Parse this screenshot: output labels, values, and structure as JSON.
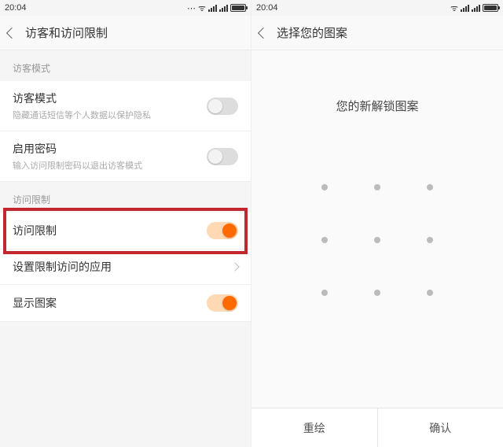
{
  "status": {
    "time": "20:04"
  },
  "left": {
    "nav_title": "访客和访问限制",
    "section_guest": "访客模式",
    "row_guest": {
      "title": "访客模式",
      "subtitle": "隐藏通话短信等个人数据以保护隐私"
    },
    "row_password": {
      "title": "启用密码",
      "subtitle": "输入访问限制密码以退出访客模式"
    },
    "section_restrict": "访问限制",
    "row_restrict": {
      "title": "访问限制"
    },
    "row_apps": {
      "title": "设置限制访问的应用"
    },
    "row_show_pattern": {
      "title": "显示图案"
    }
  },
  "right": {
    "nav_title": "选择您的图案",
    "pattern_title": "您的新解锁图案",
    "btn_redraw": "重绘",
    "btn_confirm": "确认"
  },
  "colors": {
    "accent": "#ff6a00",
    "highlight": "#c1272d"
  }
}
